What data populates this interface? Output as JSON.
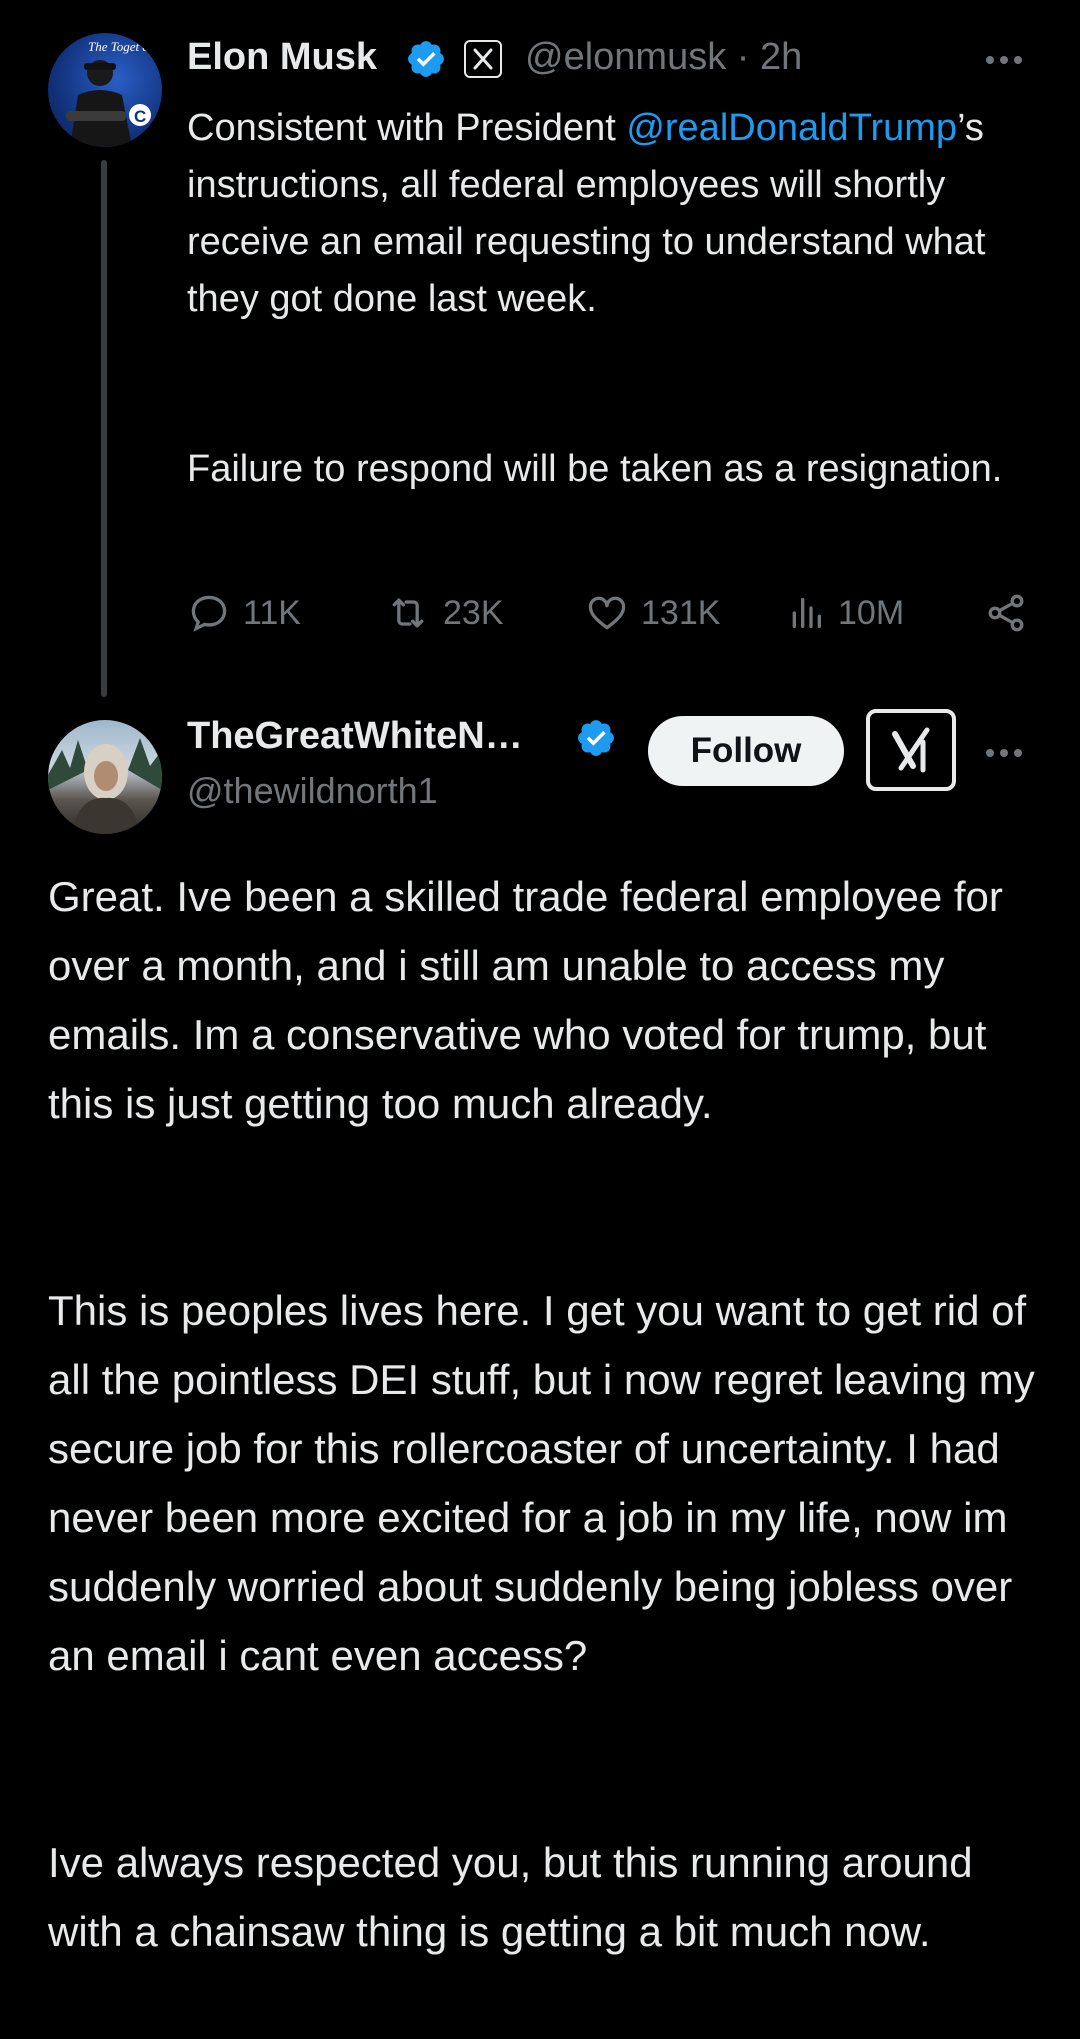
{
  "tweet": {
    "author_name": "Elon Musk",
    "handle": "@elonmusk",
    "time": "· 2h",
    "paragraph1_before": "Consistent with President ",
    "mention": "@realDonaldTrump",
    "paragraph1_after": "’s instructions, all federal employees will shortly receive an email requesting to understand what they got done last week.",
    "paragraph2": "Failure to respond will be taken as a resignation.",
    "stats": {
      "replies": "11K",
      "reposts": "23K",
      "likes": "131K",
      "views": "10M"
    },
    "avatar_text": "The Toget a"
  },
  "reply": {
    "author_name": "TheGreatWhiteN…",
    "handle": "@thewildnorth1",
    "follow_label": "Follow",
    "paragraphs": [
      "Great. Ive been a skilled trade federal employee for over a month, and i still am unable to access my emails. Im a conservative who voted for trump, but this is just getting too much already.",
      "This is peoples lives here. I get you want to get rid of all the pointless DEI stuff, but i now regret leaving my secure job for this rollercoaster of uncertainty. I had never been more excited for a job in my life, now im suddenly worried about suddenly being jobless over an email i cant even access?",
      "Ive always respected you, but this running around with a chainsaw thing is getting a bit much now."
    ]
  },
  "icons": {
    "verified": "verified-badge-icon",
    "x_affiliate": "x-logo-icon",
    "more": "more-dots-icon",
    "reply": "reply-icon",
    "repost": "repost-icon",
    "like": "heart-icon",
    "views": "views-icon",
    "share": "share-icon",
    "grok": "grok-icon"
  },
  "colors": {
    "background": "#000000",
    "text": "#e7e9ea",
    "muted": "#71767b",
    "link": "#1d9bf0",
    "verified": "#1d9bf0"
  }
}
